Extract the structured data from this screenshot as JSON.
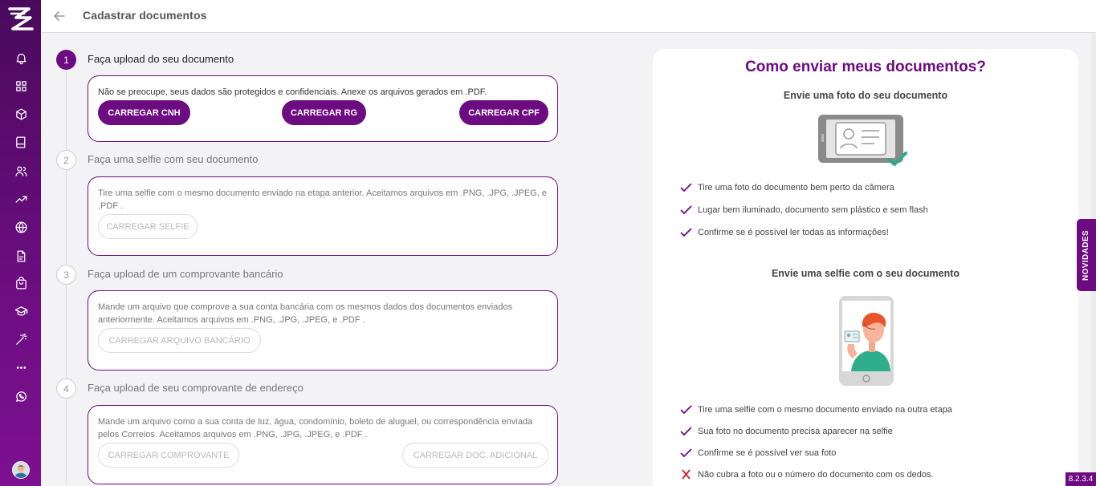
{
  "header": {
    "title": "Cadastrar documentos"
  },
  "sidebar": {
    "items": [
      "bell-icon",
      "grid-icon",
      "box-icon",
      "book-icon",
      "users-icon",
      "trending-icon",
      "globe-icon",
      "file-icon",
      "bag-icon",
      "graduation-icon",
      "magic-wand-icon",
      "more-icon",
      "whatsapp-icon"
    ]
  },
  "steps": [
    {
      "number": "1",
      "title": "Faça upload do seu documento",
      "text": "Não se preocupe, seus dados são protegidos e confidenciais. Anexe os arquivos gerados em .PDF.",
      "buttons": [
        "CARREGAR CNH",
        "CARREGAR RG",
        "CARREGAR CPF"
      ]
    },
    {
      "number": "2",
      "title": "Faça uma selfie com seu documento",
      "text": "Tire uma selfie com o mesmo documento enviado na etapa anterior. Aceitamos arquivos em .PNG, .JPG, .JPEG, e .PDF .",
      "buttons": [
        "CARREGAR SELFIE"
      ]
    },
    {
      "number": "3",
      "title": "Faça upload de um comprovante bancário",
      "text": "Mande um arquivo que comprove a sua conta bancária com os mesmos dados dos documentos enviados anteriormente. Aceitamos arquivos em .PNG, .JPG, .JPEG, e .PDF .",
      "buttons": [
        "CARREGAR ARQUIVO BANCÁRIO"
      ]
    },
    {
      "number": "4",
      "title": "Faça upload de seu comprovante de endereço",
      "text": "Mande um arquivo como a sua conta de luz, água, condomínio, boleto de aluguel, ou correspondência enviada pelos Correios. Aceitamos arquivos em .PNG, .JPG, .JPEG, e .PDF .",
      "buttons": [
        "CARREGAR COMPROVANTE",
        "CARREGAR DOC. ADICIONAL"
      ]
    }
  ],
  "panel": {
    "title": "Como enviar meus documentos?",
    "section1": {
      "subtitle": "Envie uma foto do seu documento",
      "items": [
        "Tire uma foto do documento bem perto da câmera",
        "Lugar bem iluminado, documento sem plástico e sem flash",
        "Confirme se é possível ler todas as informações!"
      ]
    },
    "section2": {
      "subtitle": "Envie uma selfie com o seu documento",
      "items": [
        "Tire uma selfie com o mesmo documento enviado na outra etapa",
        "Sua foto no documento precisa aparecer na selfie",
        "Confirme se é possível ver sua foto",
        "Não cubra a foto ou o número do documento com os dedos."
      ]
    }
  },
  "news_tab": "NOVIDADES",
  "version": "8.2.3.4",
  "colors": {
    "brand": "#6d0b80",
    "check": "#6d0b80",
    "cross": "#d9232e"
  }
}
